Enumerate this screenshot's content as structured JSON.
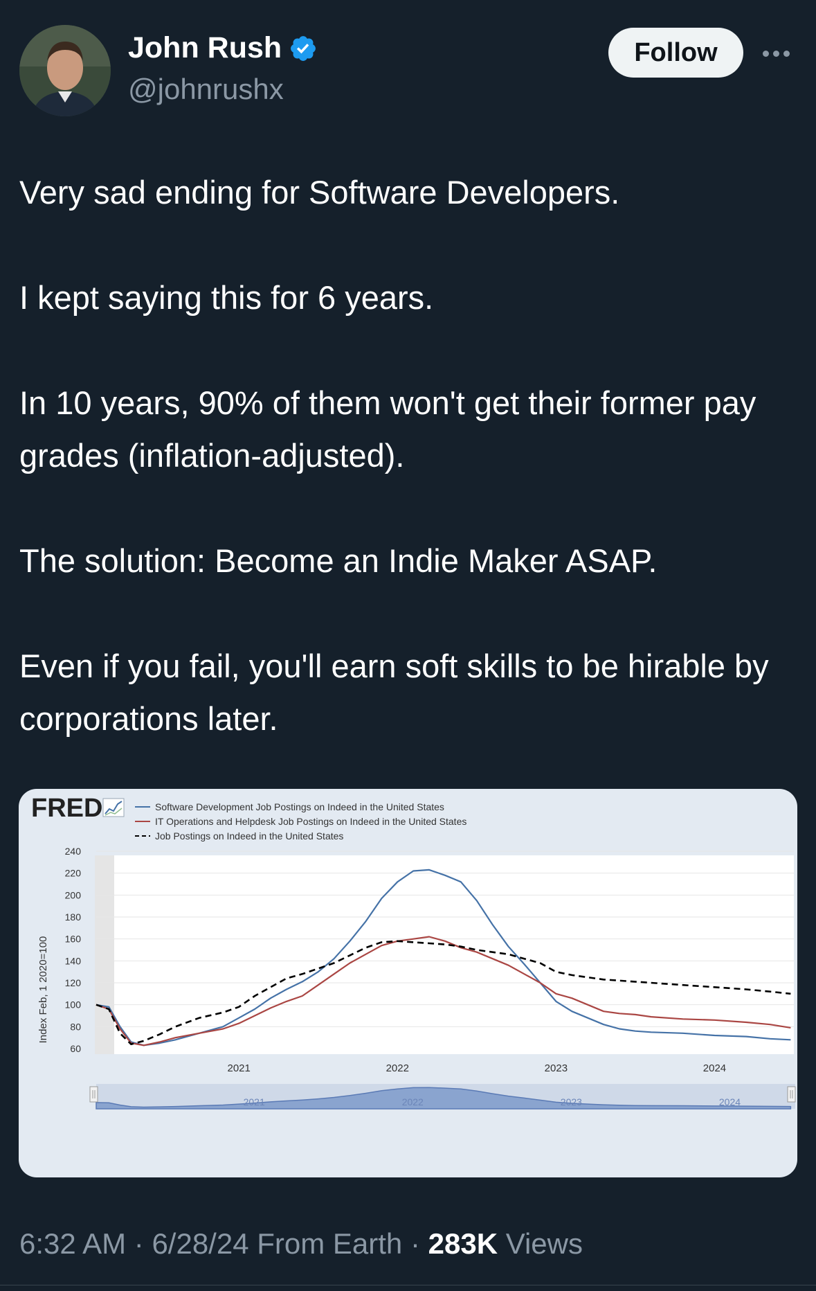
{
  "author": {
    "name": "John Rush",
    "handle": "@johnrushx",
    "verified": true,
    "avatar_icon": "profile-photo"
  },
  "header": {
    "follow_label": "Follow",
    "more_icon": "ellipsis-icon"
  },
  "tweet": {
    "paragraphs": [
      "Very sad ending for Software Developers.",
      "I kept saying this for 6 years.",
      "In 10 years, 90% of them won't get their former pay grades (inflation-adjusted).",
      "The solution: Become an Indie Maker ASAP.",
      "Even if you fail, you'll earn soft skills to be hirable by corporations later."
    ]
  },
  "chart_data": {
    "type": "line",
    "brand": "FRED",
    "ylabel": "Index Feb, 1 2020=100",
    "ylim": [
      60,
      240
    ],
    "yticks": [
      60,
      80,
      100,
      120,
      140,
      160,
      180,
      200,
      220,
      240
    ],
    "xlim": [
      2020.1,
      2024.5
    ],
    "xticks": [
      "2021",
      "2022",
      "2023",
      "2024"
    ],
    "legend_position": "top",
    "series": [
      {
        "name": "Software Development Job Postings on Indeed in the United States",
        "color": "#4572a7",
        "style": "solid",
        "points": [
          [
            2020.1,
            100
          ],
          [
            2020.18,
            98
          ],
          [
            2020.25,
            80
          ],
          [
            2020.32,
            66
          ],
          [
            2020.4,
            63
          ],
          [
            2020.5,
            65
          ],
          [
            2020.6,
            68
          ],
          [
            2020.75,
            74
          ],
          [
            2020.9,
            80
          ],
          [
            2021.0,
            88
          ],
          [
            2021.1,
            96
          ],
          [
            2021.2,
            106
          ],
          [
            2021.3,
            114
          ],
          [
            2021.4,
            121
          ],
          [
            2021.5,
            130
          ],
          [
            2021.6,
            142
          ],
          [
            2021.7,
            158
          ],
          [
            2021.8,
            176
          ],
          [
            2021.9,
            197
          ],
          [
            2022.0,
            212
          ],
          [
            2022.1,
            222
          ],
          [
            2022.2,
            223
          ],
          [
            2022.3,
            218
          ],
          [
            2022.4,
            212
          ],
          [
            2022.5,
            195
          ],
          [
            2022.6,
            173
          ],
          [
            2022.7,
            153
          ],
          [
            2022.8,
            137
          ],
          [
            2022.9,
            120
          ],
          [
            2023.0,
            103
          ],
          [
            2023.1,
            94
          ],
          [
            2023.2,
            88
          ],
          [
            2023.3,
            82
          ],
          [
            2023.4,
            78
          ],
          [
            2023.5,
            76
          ],
          [
            2023.6,
            75
          ],
          [
            2023.8,
            74
          ],
          [
            2024.0,
            72
          ],
          [
            2024.2,
            71
          ],
          [
            2024.35,
            69
          ],
          [
            2024.48,
            68
          ]
        ]
      },
      {
        "name": "IT Operations and Helpdesk Job Postings on Indeed in the United States",
        "color": "#aa4643",
        "style": "solid",
        "points": [
          [
            2020.1,
            100
          ],
          [
            2020.18,
            96
          ],
          [
            2020.25,
            78
          ],
          [
            2020.32,
            65
          ],
          [
            2020.4,
            63
          ],
          [
            2020.5,
            66
          ],
          [
            2020.6,
            70
          ],
          [
            2020.75,
            74
          ],
          [
            2020.9,
            78
          ],
          [
            2021.0,
            83
          ],
          [
            2021.1,
            90
          ],
          [
            2021.2,
            97
          ],
          [
            2021.3,
            103
          ],
          [
            2021.4,
            108
          ],
          [
            2021.5,
            118
          ],
          [
            2021.6,
            128
          ],
          [
            2021.7,
            138
          ],
          [
            2021.8,
            146
          ],
          [
            2021.9,
            154
          ],
          [
            2022.0,
            158
          ],
          [
            2022.1,
            160
          ],
          [
            2022.2,
            162
          ],
          [
            2022.3,
            158
          ],
          [
            2022.4,
            152
          ],
          [
            2022.5,
            148
          ],
          [
            2022.6,
            142
          ],
          [
            2022.7,
            136
          ],
          [
            2022.8,
            128
          ],
          [
            2022.9,
            120
          ],
          [
            2023.0,
            110
          ],
          [
            2023.1,
            106
          ],
          [
            2023.2,
            100
          ],
          [
            2023.3,
            94
          ],
          [
            2023.4,
            92
          ],
          [
            2023.5,
            91
          ],
          [
            2023.6,
            89
          ],
          [
            2023.8,
            87
          ],
          [
            2024.0,
            86
          ],
          [
            2024.2,
            84
          ],
          [
            2024.35,
            82
          ],
          [
            2024.48,
            79
          ]
        ]
      },
      {
        "name": "Job Postings on Indeed in the United States",
        "color": "#000000",
        "style": "dashed",
        "points": [
          [
            2020.1,
            100
          ],
          [
            2020.18,
            96
          ],
          [
            2020.25,
            74
          ],
          [
            2020.32,
            64
          ],
          [
            2020.4,
            67
          ],
          [
            2020.5,
            73
          ],
          [
            2020.6,
            80
          ],
          [
            2020.75,
            88
          ],
          [
            2020.9,
            93
          ],
          [
            2021.0,
            98
          ],
          [
            2021.1,
            108
          ],
          [
            2021.2,
            116
          ],
          [
            2021.3,
            124
          ],
          [
            2021.4,
            128
          ],
          [
            2021.5,
            133
          ],
          [
            2021.6,
            138
          ],
          [
            2021.7,
            145
          ],
          [
            2021.8,
            152
          ],
          [
            2021.9,
            157
          ],
          [
            2022.0,
            158
          ],
          [
            2022.1,
            157
          ],
          [
            2022.2,
            156
          ],
          [
            2022.3,
            155
          ],
          [
            2022.4,
            153
          ],
          [
            2022.5,
            150
          ],
          [
            2022.6,
            148
          ],
          [
            2022.7,
            146
          ],
          [
            2022.8,
            142
          ],
          [
            2022.9,
            138
          ],
          [
            2023.0,
            130
          ],
          [
            2023.1,
            127
          ],
          [
            2023.2,
            125
          ],
          [
            2023.3,
            123
          ],
          [
            2023.4,
            122
          ],
          [
            2023.5,
            121
          ],
          [
            2023.6,
            120
          ],
          [
            2023.8,
            118
          ],
          [
            2024.0,
            116
          ],
          [
            2024.2,
            114
          ],
          [
            2024.35,
            112
          ],
          [
            2024.48,
            110
          ]
        ]
      }
    ],
    "navigator_labels": [
      "2021",
      "2022",
      "2023",
      "2024"
    ]
  },
  "footer": {
    "time": "6:32 AM",
    "date": "6/28/24",
    "source": "From Earth",
    "views_count": "283K",
    "views_label": "Views"
  }
}
